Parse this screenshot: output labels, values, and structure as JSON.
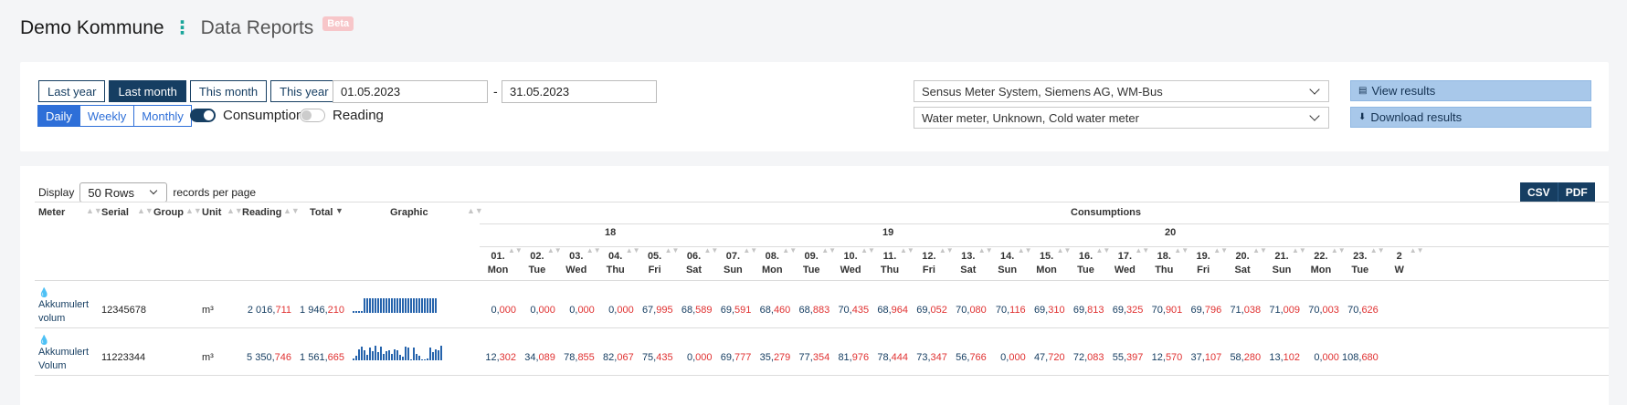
{
  "header": {
    "app_title": "Demo Kommune",
    "page_title": "Data Reports",
    "badge": "Beta"
  },
  "filters": {
    "period_buttons": [
      "Last year",
      "Last month",
      "This month",
      "This year"
    ],
    "active_period": "Last month",
    "resolutions": [
      "Daily",
      "Weekly",
      "Monthly"
    ],
    "active_resolution": "Daily",
    "toggle_consumption": "Consumption",
    "toggle_reading": "Reading",
    "date_from": "01.05.2023",
    "date_separator": "-",
    "date_to": "31.05.2023",
    "system_select": "Sensus Meter System, Siemens AG, WM-Bus",
    "meter_type_select": "Water meter, Unknown, Cold water meter",
    "view_button": "View results",
    "download_button": "Download results"
  },
  "table": {
    "display_label": "Display",
    "rows_option": "50 Rows",
    "per_page_label": "records per page",
    "export": [
      "CSV",
      "PDF"
    ],
    "columns": {
      "meter": "Meter",
      "serial": "Serial",
      "group": "Group",
      "unit": "Unit",
      "reading": "Reading",
      "total": "Total",
      "graphic": "Graphic",
      "consumptions": "Consumptions"
    },
    "weeks": [
      "18",
      "19",
      "20"
    ],
    "days": [
      {
        "date": "01.",
        "dow": "Mon"
      },
      {
        "date": "02.",
        "dow": "Tue"
      },
      {
        "date": "03.",
        "dow": "Wed"
      },
      {
        "date": "04.",
        "dow": "Thu"
      },
      {
        "date": "05.",
        "dow": "Fri"
      },
      {
        "date": "06.",
        "dow": "Sat"
      },
      {
        "date": "07.",
        "dow": "Sun"
      },
      {
        "date": "08.",
        "dow": "Mon"
      },
      {
        "date": "09.",
        "dow": "Tue"
      },
      {
        "date": "10.",
        "dow": "Wed"
      },
      {
        "date": "11.",
        "dow": "Thu"
      },
      {
        "date": "12.",
        "dow": "Fri"
      },
      {
        "date": "13.",
        "dow": "Sat"
      },
      {
        "date": "14.",
        "dow": "Sun"
      },
      {
        "date": "15.",
        "dow": "Mon"
      },
      {
        "date": "16.",
        "dow": "Tue"
      },
      {
        "date": "17.",
        "dow": "Wed"
      },
      {
        "date": "18.",
        "dow": "Thu"
      },
      {
        "date": "19.",
        "dow": "Fri"
      },
      {
        "date": "20.",
        "dow": "Sat"
      },
      {
        "date": "21.",
        "dow": "Sun"
      },
      {
        "date": "22.",
        "dow": "Mon"
      },
      {
        "date": "23.",
        "dow": "Tue"
      },
      {
        "date": "2",
        "dow": "W"
      }
    ],
    "rows": [
      {
        "meter": "Akkumulert volum",
        "serial": "12345678",
        "group": "",
        "unit": "m³",
        "reading": [
          "2 016,",
          "711"
        ],
        "total": [
          "1 946,",
          "210"
        ],
        "spark": [
          1,
          1,
          1,
          1,
          10,
          10,
          10,
          10,
          10,
          10,
          10,
          10,
          10,
          10,
          10,
          10,
          10,
          10,
          10,
          10,
          10,
          10,
          10,
          10,
          10,
          10,
          10,
          10,
          10,
          10,
          10
        ],
        "values": [
          [
            "0,",
            "000"
          ],
          [
            "0,",
            "000"
          ],
          [
            "0,",
            "000"
          ],
          [
            "0,",
            "000"
          ],
          [
            "67,",
            "995"
          ],
          [
            "68,",
            "589"
          ],
          [
            "69,",
            "591"
          ],
          [
            "68,",
            "460"
          ],
          [
            "68,",
            "883"
          ],
          [
            "70,",
            "435"
          ],
          [
            "68,",
            "964"
          ],
          [
            "69,",
            "052"
          ],
          [
            "70,",
            "080"
          ],
          [
            "70,",
            "116"
          ],
          [
            "69,",
            "310"
          ],
          [
            "69,",
            "813"
          ],
          [
            "69,",
            "325"
          ],
          [
            "70,",
            "901"
          ],
          [
            "69,",
            "796"
          ],
          [
            "71,",
            "038"
          ],
          [
            "71,",
            "009"
          ],
          [
            "70,",
            "003"
          ],
          [
            "70,",
            "626"
          ],
          [
            "",
            ""
          ]
        ]
      },
      {
        "meter": "Akkumulert Volum",
        "serial": "11223344",
        "group": "",
        "unit": "m³",
        "reading": [
          "5 350,",
          "746"
        ],
        "total": [
          "1 561,",
          "665"
        ],
        "spark": [
          2,
          4,
          10,
          12,
          9,
          5,
          11,
          8,
          13,
          7,
          12,
          6,
          8,
          9,
          6,
          10,
          9,
          5,
          3,
          12,
          11,
          0,
          11,
          6,
          4,
          0,
          1,
          2,
          11,
          7,
          10,
          9,
          13
        ],
        "values": [
          [
            "12,",
            "302"
          ],
          [
            "34,",
            "089"
          ],
          [
            "78,",
            "855"
          ],
          [
            "82,",
            "067"
          ],
          [
            "75,",
            "435"
          ],
          [
            "0,",
            "000"
          ],
          [
            "69,",
            "777"
          ],
          [
            "35,",
            "279"
          ],
          [
            "77,",
            "354"
          ],
          [
            "81,",
            "976"
          ],
          [
            "78,",
            "444"
          ],
          [
            "73,",
            "347"
          ],
          [
            "56,",
            "766"
          ],
          [
            "0,",
            "000"
          ],
          [
            "47,",
            "720"
          ],
          [
            "72,",
            "083"
          ],
          [
            "55,",
            "397"
          ],
          [
            "12,",
            "570"
          ],
          [
            "37,",
            "107"
          ],
          [
            "58,",
            "280"
          ],
          [
            "13,",
            "102"
          ],
          [
            "0,",
            "000"
          ],
          [
            "108,",
            "680"
          ],
          [
            "",
            ""
          ]
        ]
      }
    ]
  }
}
